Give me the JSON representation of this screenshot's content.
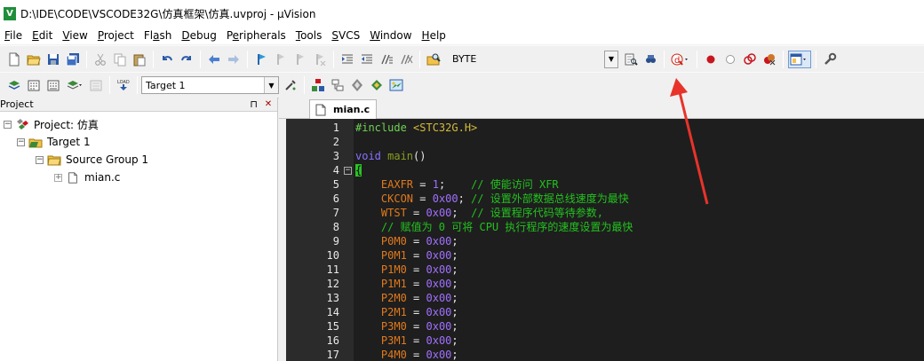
{
  "window": {
    "icon_letter": "V",
    "title": "D:\\IDE\\CODE\\VSCODE32G\\仿真框架\\仿真.uvproj - µVision"
  },
  "menu": [
    {
      "label": "File",
      "key": "F",
      "rest": "ile"
    },
    {
      "label": "Edit",
      "key": "E",
      "rest": "dit"
    },
    {
      "label": "View",
      "key": "V",
      "rest": "iew"
    },
    {
      "label": "Project",
      "key": "P",
      "rest": "roject"
    },
    {
      "label": "Flash",
      "key": "a",
      "pre": "Fl",
      "rest": "sh"
    },
    {
      "label": "Debug",
      "key": "D",
      "rest": "ebug"
    },
    {
      "label": "Peripherals",
      "key": "e",
      "pre": "P",
      "rest": "ripherals"
    },
    {
      "label": "Tools",
      "key": "T",
      "rest": "ools"
    },
    {
      "label": "SVCS",
      "key": "S",
      "rest": "VCS"
    },
    {
      "label": "Window",
      "key": "W",
      "rest": "indow"
    },
    {
      "label": "Help",
      "key": "H",
      "rest": "elp"
    }
  ],
  "toolbar": {
    "find_value": "BYTE",
    "target_value": "Target 1"
  },
  "project": {
    "header": "Project",
    "pin": "⊓",
    "close": "✕",
    "root": "Project: 仿真",
    "target": "Target 1",
    "group": "Source Group 1",
    "file": "mian.c"
  },
  "editor": {
    "tab_label": "mian.c",
    "lines": [
      {
        "n": "1",
        "tokens": [
          [
            "pre",
            "#include "
          ],
          [
            "str",
            "<STC32G.H>"
          ]
        ]
      },
      {
        "n": "2",
        "tokens": []
      },
      {
        "n": "3",
        "tokens": [
          [
            "kw",
            "void "
          ],
          [
            "ok",
            "main"
          ],
          [
            "id",
            "()"
          ]
        ]
      },
      {
        "n": "4",
        "tokens": [
          [
            "brace",
            "{"
          ]
        ],
        "fold": "−"
      },
      {
        "n": "5",
        "tokens": [
          [
            "id",
            "    "
          ],
          [
            "reg",
            "EAXFR"
          ],
          [
            "op",
            " = "
          ],
          [
            "num",
            "1"
          ],
          [
            "op",
            ";    "
          ],
          [
            "cm",
            "// 使能访问 XFR"
          ]
        ]
      },
      {
        "n": "6",
        "tokens": [
          [
            "id",
            "    "
          ],
          [
            "reg",
            "CKCON"
          ],
          [
            "op",
            " = "
          ],
          [
            "num",
            "0x00"
          ],
          [
            "op",
            "; "
          ],
          [
            "cm",
            "// 设置外部数据总线速度为最快"
          ]
        ]
      },
      {
        "n": "7",
        "tokens": [
          [
            "id",
            "    "
          ],
          [
            "reg",
            "WTST"
          ],
          [
            "op",
            " = "
          ],
          [
            "num",
            "0x00"
          ],
          [
            "op",
            ";  "
          ],
          [
            "cm",
            "// 设置程序代码等待参数,"
          ]
        ]
      },
      {
        "n": "8",
        "tokens": [
          [
            "id",
            "    "
          ],
          [
            "cm",
            "// 赋值为 0 可将 CPU 执行程序的速度设置为最快"
          ]
        ]
      },
      {
        "n": "9",
        "tokens": [
          [
            "id",
            "    "
          ],
          [
            "reg",
            "P0M0"
          ],
          [
            "op",
            " = "
          ],
          [
            "num",
            "0x00"
          ],
          [
            "op",
            ";"
          ]
        ]
      },
      {
        "n": "10",
        "tokens": [
          [
            "id",
            "    "
          ],
          [
            "reg",
            "P0M1"
          ],
          [
            "op",
            " = "
          ],
          [
            "num",
            "0x00"
          ],
          [
            "op",
            ";"
          ]
        ]
      },
      {
        "n": "11",
        "tokens": [
          [
            "id",
            "    "
          ],
          [
            "reg",
            "P1M0"
          ],
          [
            "op",
            " = "
          ],
          [
            "num",
            "0x00"
          ],
          [
            "op",
            ";"
          ]
        ]
      },
      {
        "n": "12",
        "tokens": [
          [
            "id",
            "    "
          ],
          [
            "reg",
            "P1M1"
          ],
          [
            "op",
            " = "
          ],
          [
            "num",
            "0x00"
          ],
          [
            "op",
            ";"
          ]
        ]
      },
      {
        "n": "13",
        "tokens": [
          [
            "id",
            "    "
          ],
          [
            "reg",
            "P2M0"
          ],
          [
            "op",
            " = "
          ],
          [
            "num",
            "0x00"
          ],
          [
            "op",
            ";"
          ]
        ]
      },
      {
        "n": "14",
        "tokens": [
          [
            "id",
            "    "
          ],
          [
            "reg",
            "P2M1"
          ],
          [
            "op",
            " = "
          ],
          [
            "num",
            "0x00"
          ],
          [
            "op",
            ";"
          ]
        ]
      },
      {
        "n": "15",
        "tokens": [
          [
            "id",
            "    "
          ],
          [
            "reg",
            "P3M0"
          ],
          [
            "op",
            " = "
          ],
          [
            "num",
            "0x00"
          ],
          [
            "op",
            ";"
          ]
        ]
      },
      {
        "n": "16",
        "tokens": [
          [
            "id",
            "    "
          ],
          [
            "reg",
            "P3M1"
          ],
          [
            "op",
            " = "
          ],
          [
            "num",
            "0x00"
          ],
          [
            "op",
            ";"
          ]
        ]
      },
      {
        "n": "17",
        "tokens": [
          [
            "id",
            "    "
          ],
          [
            "reg",
            "P4M0"
          ],
          [
            "op",
            " = "
          ],
          [
            "num",
            "0x00"
          ],
          [
            "op",
            ";"
          ]
        ]
      }
    ]
  },
  "colors": {
    "editor_bg": "#1e1e1e",
    "annotation_arrow": "#e8332a"
  }
}
